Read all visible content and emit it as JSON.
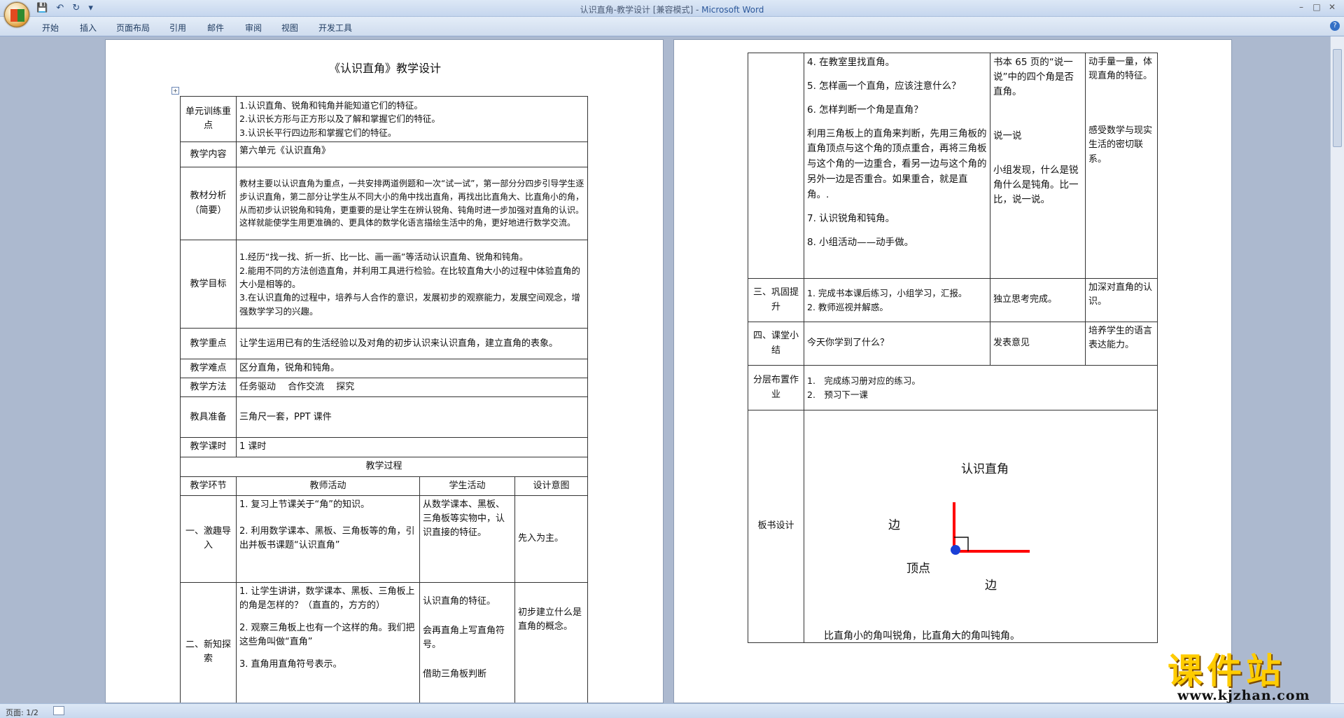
{
  "window": {
    "title": "认识直角-教学设计 [兼容模式] - ",
    "app": "Microsoft Word"
  },
  "ribbon": {
    "tabs": [
      "开始",
      "插入",
      "页面布局",
      "引用",
      "邮件",
      "审阅",
      "视图",
      "开发工具"
    ]
  },
  "status": {
    "page": "页面: 1/2"
  },
  "page1": {
    "title": "《认识直角》教学设计",
    "rows": [
      {
        "label": "单元训练重点",
        "lines": [
          "1.认识直角、锐角和钝角并能知道它们的特征。",
          "2.认识长方形与正方形以及了解和掌握它们的特征。",
          "3.认识长平行四边形和掌握它们的特征。"
        ]
      },
      {
        "label": "教学内容",
        "text": "第六单元《认识直角》"
      },
      {
        "label": "教材分析（简要）",
        "text": "教材主要以认识直角为重点，一共安排两道例题和一次“试一试”，第一部分分四步引导学生逐步认识直角，第二部分让学生从不同大小的角中找出直角，再找出比直角大、比直角小的角，从而初步认识锐角和钝角，更重要的是让学生在辨认锐角、钝角时进一步加强对直角的认识。这样就能使学生用更准确的、更具体的数学化语言描绘生活中的角，更好地进行数学交流。"
      },
      {
        "label": "教学目标",
        "lines": [
          "1.经历“找一找、折一折、比一比、画一画”等活动认识直角、锐角和钝角。",
          "2.能用不同的方法创造直角，并利用工具进行检验。在比较直角大小的过程中体验直角的大小是相等的。",
          "3.在认识直角的过程中，培养与人合作的意识，发展初步的观察能力，发展空间观念，增强数学学习的兴趣。"
        ]
      },
      {
        "label": "教学重点",
        "text": "让学生运用已有的生活经验以及对角的初步认识来认识直角，建立直角的表象。"
      },
      {
        "label": "教学难点",
        "text": "区分直角，锐角和钝角。"
      },
      {
        "label": "教学方法",
        "text": "任务驱动　 合作交流　 探究"
      },
      {
        "label": "教具准备",
        "text": "三角尺一套，PPT 课件"
      },
      {
        "label": "教学课时",
        "text": "1 课时"
      }
    ],
    "process_header": "教学过程",
    "columns": [
      "教学环节",
      "教师活动",
      "学生活动",
      "设计意图"
    ],
    "step1": {
      "label": "一、激趣导入",
      "teacher": [
        "1. 复习上节课关于“角”的知识。",
        "2. 利用数学课本、黑板、三角板等的角，引出并板书课题“认识直角”"
      ],
      "student": "从数学课本、黑板、三角板等实物中，认识直接的特征。",
      "intent": "先入为主。"
    },
    "step2": {
      "label": "二、新知探索",
      "teacher": [
        "1. 让学生讲讲，数学课本、黑板、三角板上的角是怎样的？（直直的，方方的）",
        "2. 观察三角板上也有一个这样的角。我们把这些角叫做“直角”",
        "3. 直角用直角符号表示。"
      ],
      "student": [
        "认识直角的特征。",
        "会再直角上写直角符号。",
        "借助三角板判断"
      ],
      "intent": "初步建立什么是直角的概念。"
    }
  },
  "page2": {
    "cont": {
      "teacher": [
        "4. 在教室里找直角。",
        "5. 怎样画一个直角，应该注意什么？",
        "6. 怎样判断一个角是直角？",
        "利用三角板上的直角来判断，先用三角板的直角顶点与这个角的顶点重合，再将三角板与这个角的一边重合，看另一边与这个角的另外一边是否重合。如果重合，就是直角。.",
        "7. 认识锐角和钝角。",
        "8. 小组活动——动手做。"
      ],
      "student": [
        "书本 65 页的“说一说”中的四个角是否直角。",
        "说一说",
        "小组发现，什么是锐角什么是钝角。比一比，说一说。"
      ],
      "intent": [
        "动手量一量，体现直角的特征。",
        "感受数学与现实生活的密切联系。"
      ]
    },
    "step3": {
      "label": "三、巩固提升",
      "teacher": [
        "1. 完成书本课后练习，小组学习，汇报。",
        "2. 教师巡视并解惑。"
      ],
      "student": "独立思考完成。",
      "intent": "加深对直角的认识。"
    },
    "step4": {
      "label": "四、课堂小结",
      "teacher": "今天你学到了什么？",
      "student": "发表意见",
      "intent": "培养学生的语言表达能力。"
    },
    "homework": {
      "label": "分层布置作业",
      "items": [
        "1.　完成练习册对应的练习。",
        "2.　预习下一课"
      ]
    },
    "board": {
      "label": "板书设计",
      "title": "认识直角",
      "side_left": "边",
      "vertex": "顶点",
      "side_bottom": "边",
      "note": "比直角小的角叫锐角，比直角大的角叫钝角。"
    }
  },
  "logo": {
    "text": "课件站",
    "url": "www.kjzhan.com"
  },
  "colors": {
    "ray": "#ff0000",
    "vertex": "#1a3fd6",
    "logo": "#ffcc00"
  }
}
